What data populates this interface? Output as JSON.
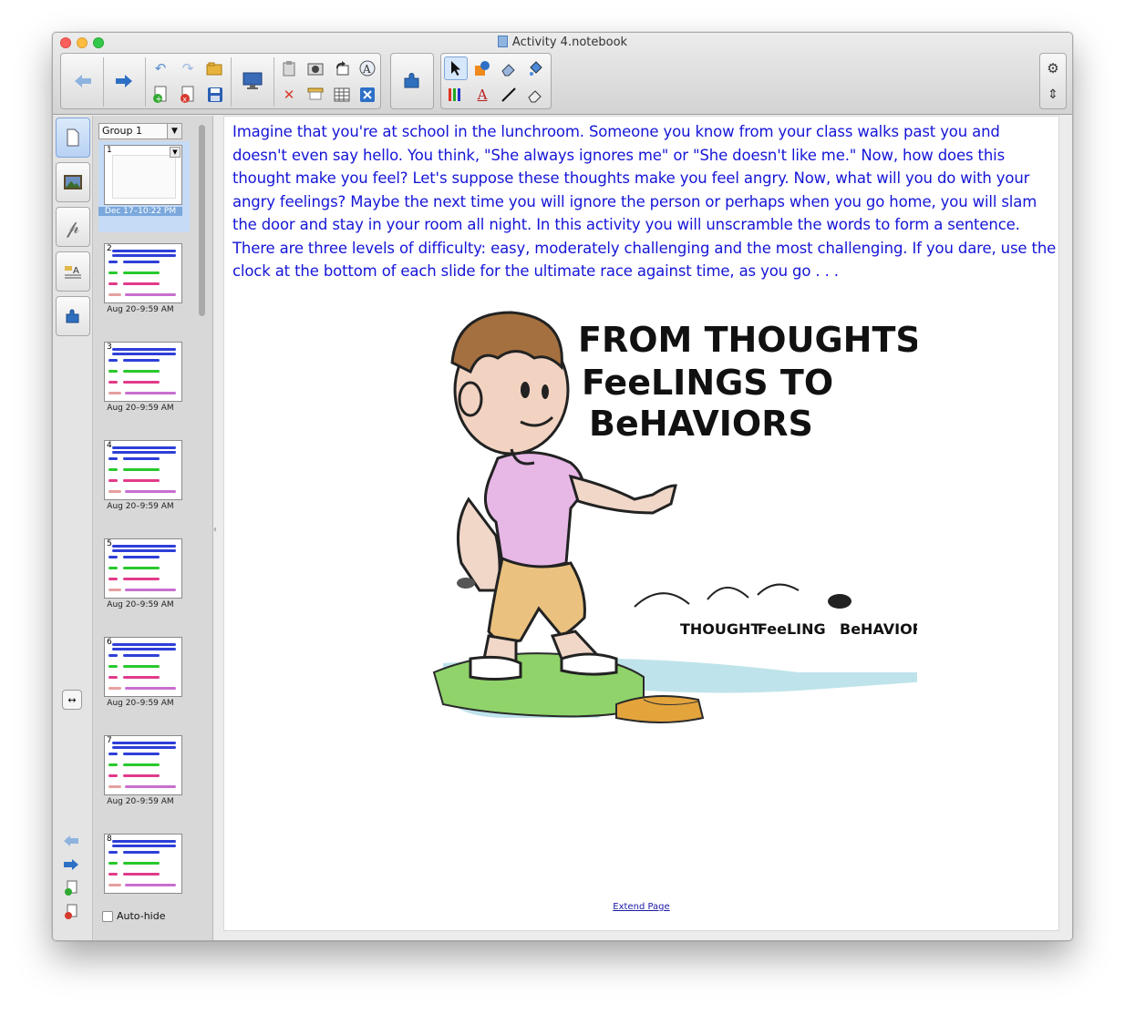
{
  "window": {
    "title": "Activity 4.notebook"
  },
  "toolbar": {
    "back_icon": "arrow-left-icon",
    "forward_icon": "arrow-right-icon",
    "undo_icon": "undo-icon",
    "redo_icon": "redo-icon",
    "open_icon": "folder-open-icon",
    "add_page_icon": "add-page-icon",
    "delete_page_icon": "delete-page-icon",
    "save_icon": "save-icon",
    "display_icon": "monitor-icon",
    "paste_icon": "paste-icon",
    "screenshot_icon": "camera-icon",
    "undo2_icon": "rotate-icon",
    "handwriting_icon": "handwriting-icon",
    "delete_icon": "delete-x-icon",
    "screen_shade_icon": "screen-shade-icon",
    "table_icon": "table-icon",
    "fullscreen_icon": "close-box-icon",
    "addon_icon": "puzzle-icon",
    "select_icon": "cursor-icon",
    "shapes_icon": "shapes-icon",
    "eraser_icon": "eraser-icon",
    "fill_icon": "fill-icon",
    "pens_icon": "pens-icon",
    "text_icon": "text-A-icon",
    "line_icon": "line-icon",
    "magic_eraser_icon": "eraser2-icon",
    "settings_icon": "gear-icon",
    "move_toolbar_icon": "updown-arrow-icon"
  },
  "sidebar_tabs": [
    "page-sorter-icon",
    "gallery-icon",
    "attachments-icon",
    "properties-icon",
    "addons-icon"
  ],
  "sorter": {
    "group_label": "Group 1",
    "auto_hide_label": "Auto-hide",
    "pages": [
      {
        "num": "1",
        "date": "Dec 17–10:22 PM",
        "selected": true
      },
      {
        "num": "2",
        "date": "Aug 20–9:59 AM"
      },
      {
        "num": "3",
        "date": "Aug 20–9:59 AM"
      },
      {
        "num": "4",
        "date": "Aug 20–9:59 AM"
      },
      {
        "num": "5",
        "date": "Aug 20–9:59 AM"
      },
      {
        "num": "6",
        "date": "Aug 20–9:59 AM"
      },
      {
        "num": "7",
        "date": "Aug 20–9:59 AM"
      },
      {
        "num": "8",
        "date": ""
      }
    ]
  },
  "page": {
    "text": "Imagine that you're at school in the lunchroom.  Someone you know from your class walks past you and doesn't even say hello.  You think, \"She always ignores me\" or \"She doesn't like me.\"  Now, how does this thought make you feel?  Let's suppose these thoughts make you feel angry.  Now, what will you do with your angry feelings?  Maybe the next time you will ignore the person or perhaps when you go home, you will slam the door and stay in your room all night.  In this activity you will unscramble the words to form a sentence.  There are three levels of difficulty: easy, moderately challenging and the most challenging.  If you dare, use the clock at the bottom of each slide for the ultimate race against time, as you go . . .",
    "cartoon_title_lines": [
      "FROM THOUGHTS TO",
      "FeeLINGS TO",
      "BeHAVIORS"
    ],
    "cartoon_labels": [
      "THOUGHT",
      "FeeLING",
      "BeHAVIOR"
    ],
    "extend_link": "Extend Page"
  },
  "colors": {
    "text_blue": "#1515d8",
    "accent": "#7ea6da"
  }
}
